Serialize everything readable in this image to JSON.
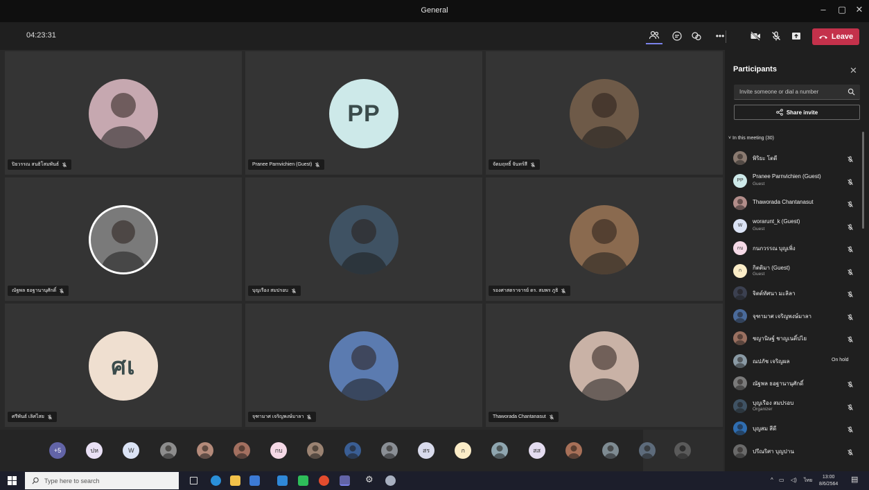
{
  "window": {
    "title": "General"
  },
  "toolbar": {
    "timer": "04:23:31",
    "leave_label": "Leave"
  },
  "tiles": [
    {
      "name": "ปิยวรรณ สนธิโสมพันธ์",
      "avatar_type": "photo",
      "bg": "#c6a8b0"
    },
    {
      "name": "Pranee Parnvichien (Guest)",
      "avatar_type": "initials",
      "initials": "PP",
      "bg": "#cde9e9"
    },
    {
      "name": "จัตมฤทธิ์ จันทร์สี",
      "avatar_type": "photo",
      "bg": "#6e5a48"
    },
    {
      "name": "ณัฐพล ธอฐานานุศักดิ์",
      "avatar_type": "photo",
      "bg": "#7a7a7a"
    },
    {
      "name": "บุญเรือง สมปรอบ",
      "avatar_type": "photo",
      "bg": "#3f5263"
    },
    {
      "name": "รองศาสตราจารย์ ดร. สมพร ภูธิ",
      "avatar_type": "photo",
      "bg": "#8a6a4f"
    },
    {
      "name": "ศรีพันธ์ เลิศไสย",
      "avatar_type": "initials",
      "initials": "ศเ",
      "bg": "#efdfd0"
    },
    {
      "name": "จุฑามาศ เจริญพงษ์มาลา",
      "avatar_type": "photo",
      "bg": "#5b7bb0"
    },
    {
      "name": "Thaworada Chantanasut",
      "avatar_type": "photo",
      "bg": "#c9b2a6"
    }
  ],
  "strip": [
    {
      "label": "+5",
      "bg": "#6264a7",
      "fg": "#ffffff"
    },
    {
      "label": "ปห",
      "bg": "#e9e0f5",
      "fg": "#333333"
    },
    {
      "label": "W",
      "bg": "#dbe3f5",
      "fg": "#333333"
    },
    {
      "label": "",
      "bg": "#8d8d8d",
      "fg": "#333333"
    },
    {
      "label": "",
      "bg": "#b48a7a",
      "fg": "#333333"
    },
    {
      "label": "",
      "bg": "#a37060",
      "fg": "#333333"
    },
    {
      "label": "กบ",
      "bg": "#f5d9e6",
      "fg": "#333333"
    },
    {
      "label": "",
      "bg": "#9b8372",
      "fg": "#333333"
    },
    {
      "label": "",
      "bg": "#3a5e94",
      "fg": "#333333"
    },
    {
      "label": "",
      "bg": "#8a8f95",
      "fg": "#333333"
    },
    {
      "label": "สร",
      "bg": "#d9dbec",
      "fg": "#333333"
    },
    {
      "label": "ก",
      "bg": "#fbecc7",
      "fg": "#333333"
    },
    {
      "label": "",
      "bg": "#8fa6b0",
      "fg": "#333333"
    },
    {
      "label": "สส",
      "bg": "#e4dcf0",
      "fg": "#333333"
    },
    {
      "label": "",
      "bg": "#a87058",
      "fg": "#333333"
    },
    {
      "label": "",
      "bg": "#7e8b92",
      "fg": "#333333"
    },
    {
      "label": "",
      "bg": "#5d6b7b",
      "fg": "#333333"
    }
  ],
  "panel": {
    "title": "Participants",
    "search_placeholder": "Invite someone or dial a number",
    "share_label": "Share invite",
    "section_label": "In this meeting (30)",
    "participants": [
      {
        "name": "พิริยะ โตดี",
        "sub": "",
        "avatar": "",
        "bg": "#8a7a70",
        "status": ""
      },
      {
        "name": "Pranee Parnvichien (Guest)",
        "sub": "Guest",
        "avatar": "PP",
        "bg": "#cde9e9",
        "status": ""
      },
      {
        "name": "Thaworada Chantanasut",
        "sub": "",
        "avatar": "",
        "bg": "#b28d8a",
        "status": ""
      },
      {
        "name": "worarunt_k (Guest)",
        "sub": "Guest",
        "avatar": "W",
        "bg": "#dbe3f5",
        "status": ""
      },
      {
        "name": "กนกวรรณ บุญเพิ่ง",
        "sub": "",
        "avatar": "กบ",
        "bg": "#f5d9e6",
        "status": ""
      },
      {
        "name": "กิตติมา (Guest)",
        "sub": "Guest",
        "avatar": "ก",
        "bg": "#fbecc7",
        "status": ""
      },
      {
        "name": "จิตต์ทัศนา มะลิลา",
        "sub": "",
        "avatar": "",
        "bg": "#3b4050",
        "status": ""
      },
      {
        "name": "จุฑามาศ เจริญพงษ์มาลา",
        "sub": "",
        "avatar": "",
        "bg": "#4a6a9a",
        "status": ""
      },
      {
        "name": "ชญานิษฐ์ ชาญเนติ์ปไย",
        "sub": "",
        "avatar": "",
        "bg": "#9a7060",
        "status": ""
      },
      {
        "name": "ณปภัช เจริญผล",
        "sub": "",
        "avatar": "",
        "bg": "#8a9aa5",
        "status": "On hold"
      },
      {
        "name": "ณัฐพล ธอฐานานุศักดิ์",
        "sub": "",
        "avatar": "",
        "bg": "#7a7a7a",
        "status": ""
      },
      {
        "name": "บุญเรือง สมปรอบ",
        "sub": "Organizer",
        "avatar": "",
        "bg": "#3f5263",
        "status": ""
      },
      {
        "name": "บุญสม สีดี",
        "sub": "",
        "avatar": "",
        "bg": "#2f6db0",
        "status": ""
      },
      {
        "name": "ปรีณริศา บุญปาน",
        "sub": "",
        "avatar": "",
        "bg": "#6a6a6a",
        "status": ""
      }
    ]
  },
  "taskbar": {
    "search_placeholder": "Type here to search",
    "lang": "ไทย",
    "time": "13:00",
    "date": "8/6/2564"
  }
}
